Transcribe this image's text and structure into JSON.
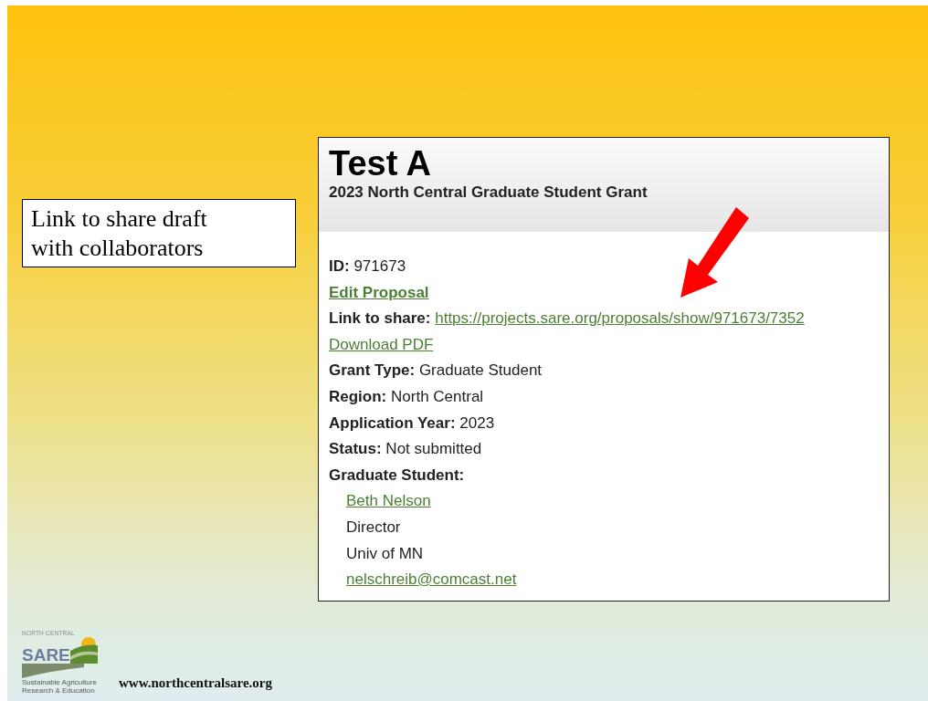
{
  "callout": {
    "text": "Link to share draft with collaborators"
  },
  "proposal": {
    "title": "Test A",
    "subtitle": "2023 North Central Graduate Student Grant",
    "rows": [
      {
        "kind": "field",
        "label": "ID:",
        "value": "971673"
      },
      {
        "kind": "bold-link",
        "value": "Edit Proposal"
      },
      {
        "kind": "field-link",
        "label": "Link to share:",
        "value": "https://projects.sare.org/proposals/show/971673/7352"
      },
      {
        "kind": "link",
        "value": "Download PDF"
      },
      {
        "kind": "field",
        "label": "Grant Type:",
        "value": "Graduate Student"
      },
      {
        "kind": "field",
        "label": "Region:",
        "value": "North Central"
      },
      {
        "kind": "field",
        "label": "Application Year:",
        "value": "2023"
      },
      {
        "kind": "field",
        "label": "Status:",
        "value": "Not submitted"
      },
      {
        "kind": "heading",
        "label": "Graduate Student:",
        "children": [
          {
            "kind": "link",
            "value": "Beth Nelson"
          },
          {
            "kind": "text",
            "value": "Director"
          },
          {
            "kind": "text",
            "value": "Univ of MN"
          },
          {
            "kind": "link",
            "value": "nelschreib@comcast.net"
          }
        ]
      }
    ]
  },
  "footer": {
    "logo_top": "NORTH CENTRAL",
    "logo_name": "SARE",
    "logo_tagline": "Sustainable Agriculture Research & Education",
    "url": "www.northcentralsare.org"
  }
}
